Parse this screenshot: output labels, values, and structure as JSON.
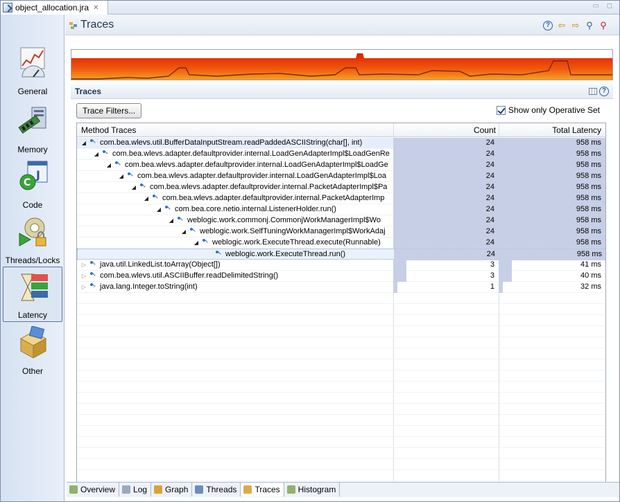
{
  "window": {
    "file_tab": "object_allocation.jra",
    "file_tab_close": "✕",
    "window_controls": "▭ ◻"
  },
  "sidebar": {
    "items": [
      {
        "label": "General",
        "icon": "general-icon"
      },
      {
        "label": "Memory",
        "icon": "memory-icon"
      },
      {
        "label": "Code",
        "icon": "code-icon"
      },
      {
        "label": "Threads/Locks",
        "icon": "threads-locks-icon"
      },
      {
        "label": "Latency",
        "icon": "latency-icon",
        "active": true
      },
      {
        "label": "Other",
        "icon": "other-icon"
      }
    ]
  },
  "header": {
    "title": "Traces"
  },
  "section": {
    "title": "Traces"
  },
  "controls": {
    "trace_filters_label": "Trace Filters...",
    "show_operative_label": "Show only Operative Set",
    "show_operative_checked": true
  },
  "table": {
    "columns": [
      "Method Traces",
      "Count",
      "Total Latency"
    ],
    "rows": [
      {
        "indent": 0,
        "expanded": true,
        "method": "com.bea.wlevs.util.BufferDataInputStream.readPaddedASCIIString(char[], int)",
        "count": "24",
        "latency": "958 ms",
        "bar": 1.0
      },
      {
        "indent": 1,
        "expanded": true,
        "method": "com.bea.wlevs.adapter.defaultprovider.internal.LoadGenAdapterImpl$LoadGenRe",
        "count": "24",
        "latency": "958 ms",
        "bar": 1.0
      },
      {
        "indent": 2,
        "expanded": true,
        "method": "com.bea.wlevs.adapter.defaultprovider.internal.LoadGenAdapterImpl$LoadGe",
        "count": "24",
        "latency": "958 ms",
        "bar": 1.0
      },
      {
        "indent": 3,
        "expanded": true,
        "method": "com.bea.wlevs.adapter.defaultprovider.internal.LoadGenAdapterImpl$Loa",
        "count": "24",
        "latency": "958 ms",
        "bar": 1.0
      },
      {
        "indent": 4,
        "expanded": true,
        "method": "com.bea.wlevs.adapter.defaultprovider.internal.PacketAdapterImpl$Pa",
        "count": "24",
        "latency": "958 ms",
        "bar": 1.0
      },
      {
        "indent": 5,
        "expanded": true,
        "method": "com.bea.wlevs.adapter.defaultprovider.internal.PacketAdapterImp",
        "count": "24",
        "latency": "958 ms",
        "bar": 1.0
      },
      {
        "indent": 6,
        "expanded": true,
        "method": "com.bea.core.netio.internal.ListenerHolder.run()",
        "count": "24",
        "latency": "958 ms",
        "bar": 1.0
      },
      {
        "indent": 7,
        "expanded": true,
        "method": "weblogic.work.commonj.CommonjWorkManagerImpl$Wo",
        "count": "24",
        "latency": "958 ms",
        "bar": 1.0
      },
      {
        "indent": 8,
        "expanded": true,
        "method": "weblogic.work.SelfTuningWorkManagerImpl$WorkAdaj",
        "count": "24",
        "latency": "958 ms",
        "bar": 1.0
      },
      {
        "indent": 9,
        "expanded": true,
        "method": "weblogic.work.ExecuteThread.execute(Runnable)",
        "count": "24",
        "latency": "958 ms",
        "bar": 1.0
      },
      {
        "indent": 10,
        "leaf": true,
        "method": "weblogic.work.ExecuteThread.run()",
        "count": "24",
        "latency": "958 ms",
        "bar": 1.0,
        "focused": true
      },
      {
        "indent": 0,
        "expanded": false,
        "method": "java.util.LinkedList.toArray(Object[])",
        "count": "3",
        "latency": "41 ms",
        "bar": 0.125
      },
      {
        "indent": 0,
        "expanded": false,
        "method": "com.bea.wlevs.util.ASCIIBuffer.readDelimitedString()",
        "count": "3",
        "latency": "40 ms",
        "bar": 0.125
      },
      {
        "indent": 0,
        "expanded": false,
        "method": "java.lang.Integer.toString(int)",
        "count": "1",
        "latency": "32 ms",
        "bar": 0.04
      }
    ]
  },
  "bottom_tabs": [
    {
      "label": "Overview",
      "color": "#8fb36b"
    },
    {
      "label": "Log",
      "color": "#9aa9bf"
    },
    {
      "label": "Graph",
      "color": "#d9a33a"
    },
    {
      "label": "Threads",
      "color": "#6d8bc0"
    },
    {
      "label": "Traces",
      "color": "#e0a84a",
      "active": true
    },
    {
      "label": "Histogram",
      "color": "#8fb36b"
    }
  ]
}
